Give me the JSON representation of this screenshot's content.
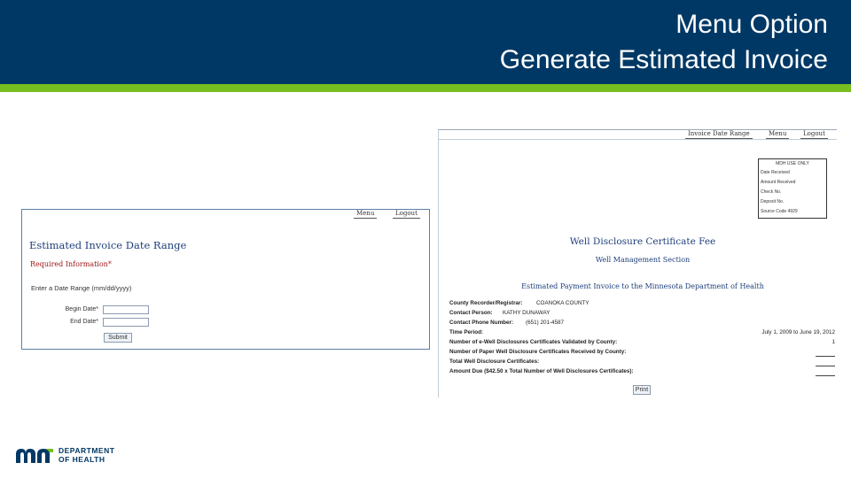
{
  "slide": {
    "title_line1": "Menu Option",
    "title_line2": "Generate Estimated Invoice",
    "colors": {
      "header": "#003865",
      "accent": "#78be20"
    }
  },
  "date_form": {
    "nav": {
      "menu": "Menu",
      "logout": "Logout"
    },
    "title": "Estimated Invoice Date Range",
    "required_info": "Required Information*",
    "date_prompt": "Enter a Date Range (mm/dd/yyyy)",
    "begin_label": "Begin Date*",
    "begin_value": "",
    "end_label": "End Date*",
    "end_value": "",
    "submit_label": "Submit"
  },
  "invoice": {
    "nav": {
      "date_range": "Invoice Date Range",
      "menu": "Menu",
      "logout": "Logout"
    },
    "office_box": {
      "header": "MDH USE ONLY",
      "date_received": "Date Received",
      "amount_received": "Amount Received",
      "check_no": "Check No.",
      "deposit_no": "Deposit No.",
      "source_code": "Source Code 4929"
    },
    "title": "Well Disclosure Certificate Fee",
    "section": "Well Management Section",
    "subtitle": "Estimated Payment Invoice to the Minnesota Department of Health",
    "county_label": "County Recorder/Registrar:",
    "county_value": "COANOKA COUNTY",
    "contact_label": "Contact Person:",
    "contact_value": "KATHY DUNAWAY",
    "phone_label": "Contact Phone Number:",
    "phone_value": "(651) 201-4587",
    "period_label": "Time Period:",
    "period_value": "July 1, 2009 to June 19, 2012",
    "ewell_label": "Number of e-Well Disclosures Certificates Validated by County:",
    "ewell_value": "1",
    "paper_label": "Number of Paper Well Disclosure Certificates Received by County:",
    "total_label": "Total Well Disclosure Certificates:",
    "amount_label": "Amount Due ($42.50 x Total Number of Well Disclosures Certificates):",
    "print_label": "Print"
  },
  "logo": {
    "line1": "DEPARTMENT",
    "line2": "OF HEALTH"
  }
}
